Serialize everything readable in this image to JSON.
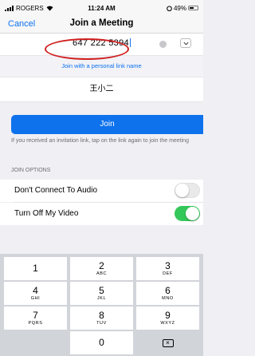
{
  "status_bar": {
    "carrier": "ROGERS",
    "time": "11:24 AM",
    "battery": "49%"
  },
  "nav": {
    "cancel_label": "Cancel",
    "title": "Join a Meeting"
  },
  "meeting_id": {
    "value": "647 222 5394"
  },
  "personal_link": {
    "label": "Join with a personal link name"
  },
  "name_field": {
    "value": "王小二"
  },
  "join_button": {
    "label": "Join"
  },
  "hint": {
    "text": "If you received an invitation link, tap on the link again to join the meeting"
  },
  "join_options": {
    "header": "JOIN OPTIONS",
    "items": [
      {
        "label": "Don't Connect To Audio",
        "enabled": false
      },
      {
        "label": "Turn Off My Video",
        "enabled": true
      }
    ]
  },
  "keypad": {
    "keys": [
      {
        "num": "1",
        "letters": ""
      },
      {
        "num": "2",
        "letters": "ABC"
      },
      {
        "num": "3",
        "letters": "DEF"
      },
      {
        "num": "4",
        "letters": "GHI"
      },
      {
        "num": "5",
        "letters": "JKL"
      },
      {
        "num": "6",
        "letters": "MNO"
      },
      {
        "num": "7",
        "letters": "PQRS"
      },
      {
        "num": "8",
        "letters": "TUV"
      },
      {
        "num": "9",
        "letters": "WXYZ"
      },
      {
        "num": "0",
        "letters": ""
      }
    ]
  },
  "colors": {
    "accent": "#0e72ed",
    "toggle_on": "#34c759",
    "highlight": "#d02020"
  }
}
